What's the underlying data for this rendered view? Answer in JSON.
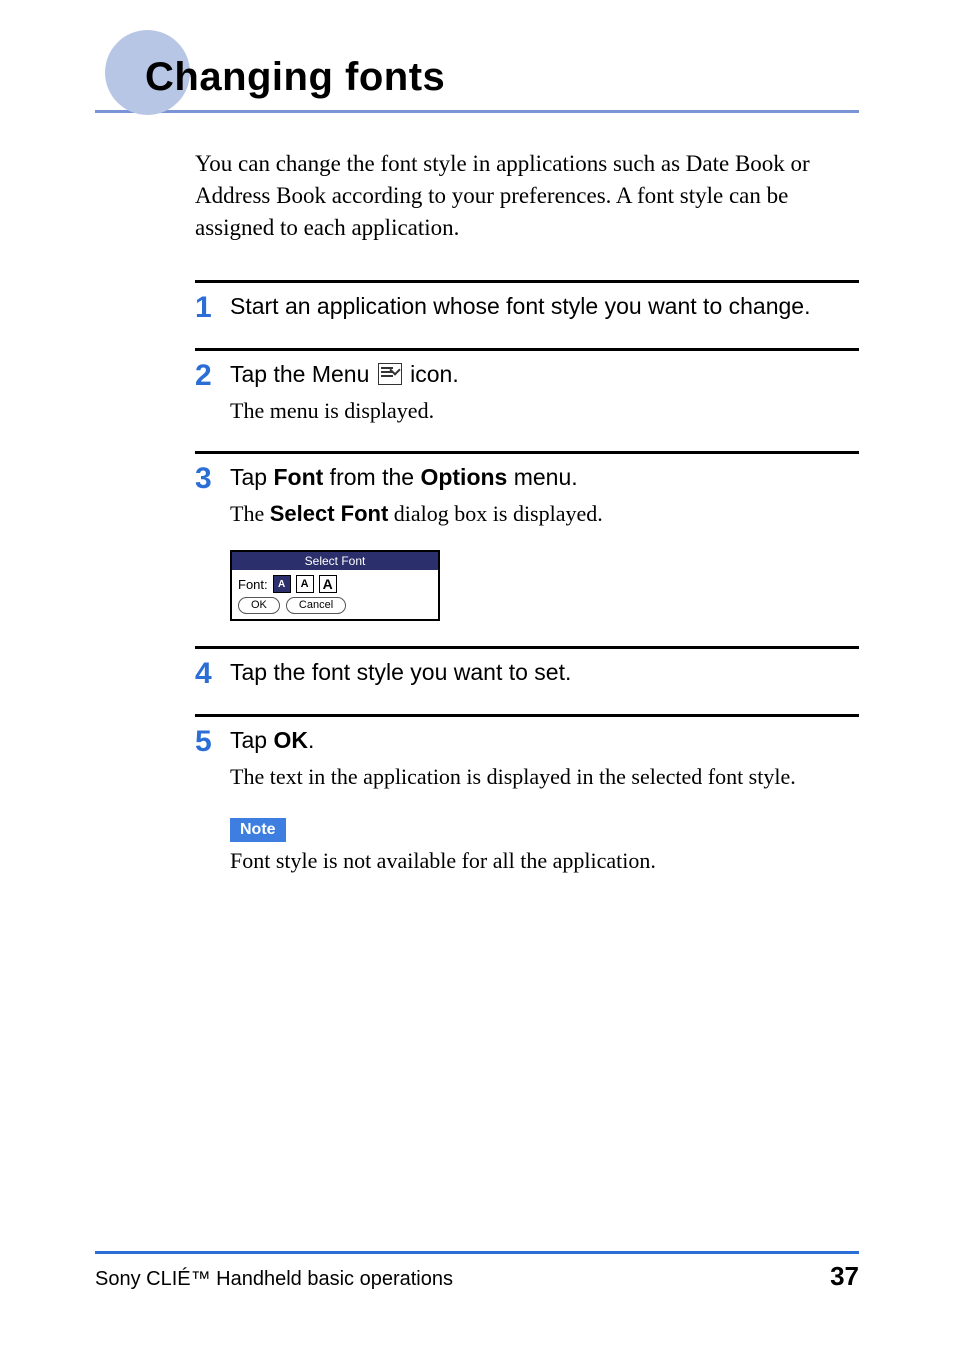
{
  "title": "Changing fonts",
  "intro": "You can change the font style in applications such as Date Book or Address Book according to your preferences. A font style can be assigned to each application.",
  "steps": [
    {
      "num": "1",
      "head": "Start an application whose font style you want to change."
    },
    {
      "num": "2",
      "head_pre": "Tap the Menu ",
      "head_post": " icon.",
      "sub": "The menu is displayed."
    },
    {
      "num": "3",
      "head_tap": "Tap ",
      "head_font": "Font",
      "head_from": " from the ",
      "head_options": "Options",
      "head_menu": " menu.",
      "sub_pre": "The ",
      "sub_bold": "Select Font",
      "sub_post": " dialog box is displayed."
    },
    {
      "num": "4",
      "head": "Tap the font style you want to set."
    },
    {
      "num": "5",
      "head_tap": "Tap ",
      "head_ok": "OK",
      "head_dot": ".",
      "sub": "The text in the application is displayed in the selected font style."
    }
  ],
  "dialog": {
    "title": "Select Font",
    "label": "Font:",
    "opt1": "A",
    "opt2": "A",
    "opt3": "A",
    "ok": "OK",
    "cancel": "Cancel"
  },
  "note": {
    "label": "Note",
    "text": "Font style is not available for all the application."
  },
  "footer": {
    "left": "Sony CLIÉ™ Handheld basic operations",
    "page": "37"
  }
}
